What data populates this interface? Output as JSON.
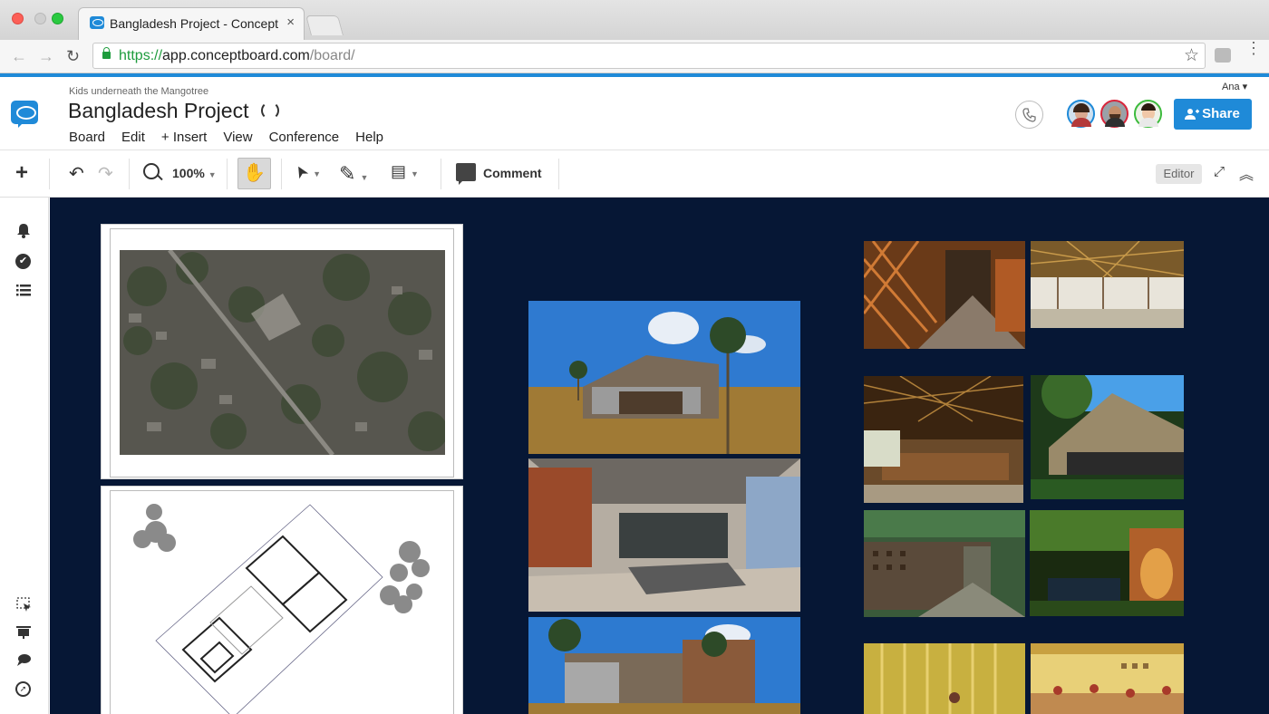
{
  "browser": {
    "tab_title": "Bangladesh Project - Concept",
    "tab_close": "×",
    "url_scheme": "https://",
    "url_host": "app.conceptboard.com",
    "url_path": "/board/",
    "nav_back": "←",
    "nav_forward": "→",
    "nav_reload": "↻",
    "star": "☆",
    "menu": "⋮"
  },
  "app": {
    "parent_title": "Kids underneath the Mangotree",
    "board_title": "Bangladesh Project",
    "user_name": "Ana ▾",
    "menu": [
      "Board",
      "Edit",
      "+ Insert",
      "View",
      "Conference",
      "Help"
    ],
    "share_label": "Share",
    "brand_color": "#1f8ad8"
  },
  "toolbar": {
    "add": "+",
    "undo": "↶",
    "redo": "↷",
    "zoom_value": "100%",
    "caret": "▼",
    "hand": "✋",
    "select": "➤",
    "pen": "✎",
    "note": "▤",
    "comment_label": "Comment",
    "editor_label": "Editor",
    "expand": "⤢",
    "collapse": "︽"
  },
  "sidebar": {
    "bell": "🔔",
    "check": "✔",
    "list": "☰",
    "select": "⬚",
    "present": "▭",
    "chat": "💬",
    "compass": "➚"
  },
  "canvas": {
    "background": "#061735",
    "aerial_label": "",
    "plan_label": ""
  }
}
